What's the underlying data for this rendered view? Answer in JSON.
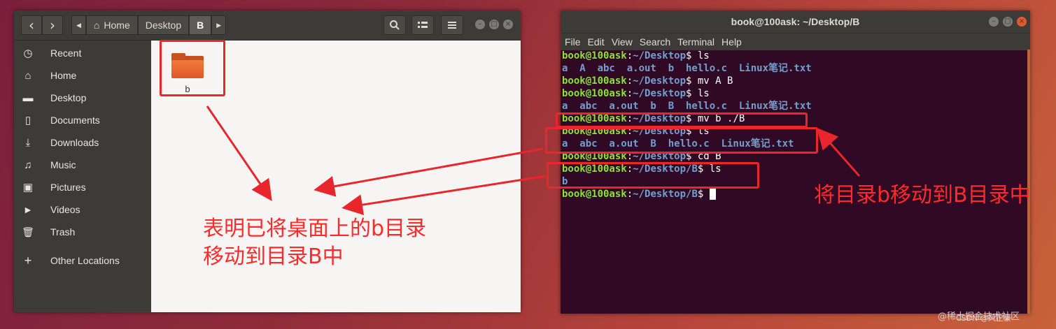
{
  "file_manager": {
    "nav": {
      "back": "‹",
      "forward": "›",
      "left_arrow": "◀",
      "right_arrow": "▶"
    },
    "breadcrumbs": [
      {
        "label": "Home",
        "icon": "home-icon"
      },
      {
        "label": "Desktop"
      },
      {
        "label": "B"
      }
    ],
    "sidebar": {
      "items": [
        {
          "label": "Recent",
          "icon": "clock-icon",
          "glyph": "◷"
        },
        {
          "label": "Home",
          "icon": "home-icon",
          "glyph": "⌂"
        },
        {
          "label": "Desktop",
          "icon": "folder-icon",
          "glyph": "▬"
        },
        {
          "label": "Documents",
          "icon": "document-icon",
          "glyph": "▯"
        },
        {
          "label": "Downloads",
          "icon": "download-icon",
          "glyph": "⤓"
        },
        {
          "label": "Music",
          "icon": "music-icon",
          "glyph": "♫"
        },
        {
          "label": "Pictures",
          "icon": "camera-icon",
          "glyph": "▣"
        },
        {
          "label": "Videos",
          "icon": "video-icon",
          "glyph": "▶"
        },
        {
          "label": "Trash",
          "icon": "trash-icon",
          "glyph": "🗑"
        },
        {
          "label": "Other Locations",
          "icon": "plus-icon",
          "glyph": "+"
        }
      ]
    },
    "files": [
      {
        "name": "b",
        "type": "folder"
      }
    ]
  },
  "terminal": {
    "title": "book@100ask: ~/Desktop/B",
    "menu": [
      "File",
      "Edit",
      "View",
      "Search",
      "Terminal",
      "Help"
    ],
    "lines": [
      {
        "user": "book@100ask",
        "path": "~/Desktop",
        "cmd": " ls"
      },
      {
        "out": "a  A  abc  a.out  b  hello.c  Linux笔记.txt"
      },
      {
        "user": "book@100ask",
        "path": "~/Desktop",
        "cmd": " mv A B"
      },
      {
        "user": "book@100ask",
        "path": "~/Desktop",
        "cmd": " ls"
      },
      {
        "out": "a  abc  a.out  b  B  hello.c  Linux笔记.txt"
      },
      {
        "user": "book@100ask",
        "path": "~/Desktop",
        "cmd": " mv b ./B"
      },
      {
        "user": "book@100ask",
        "path": "~/Desktop",
        "cmd": " ls"
      },
      {
        "out": "a  abc  a.out  B  hello.c  Linux笔记.txt"
      },
      {
        "user": "book@100ask",
        "path": "~/Desktop",
        "cmd": " cd B"
      },
      {
        "user": "book@100ask",
        "path": "~/Desktop/B",
        "cmd": " ls"
      },
      {
        "out": "b"
      },
      {
        "user": "book@100ask",
        "path": "~/Desktop/B",
        "cmd": " ",
        "cursor": true
      }
    ]
  },
  "annotations": {
    "left_note_line1": "表明已将桌面上的b目录",
    "left_note_line2": "移动到目录B中",
    "right_note": "将目录b移动到B目录中"
  },
  "watermark": "@稀土掘金技术社区",
  "watermark2": "CSDN @风正豪",
  "colors": {
    "annotation": "#e8262b",
    "terminal_bg": "#300a24",
    "prompt_user": "#8ae234",
    "prompt_path": "#729fcf"
  }
}
